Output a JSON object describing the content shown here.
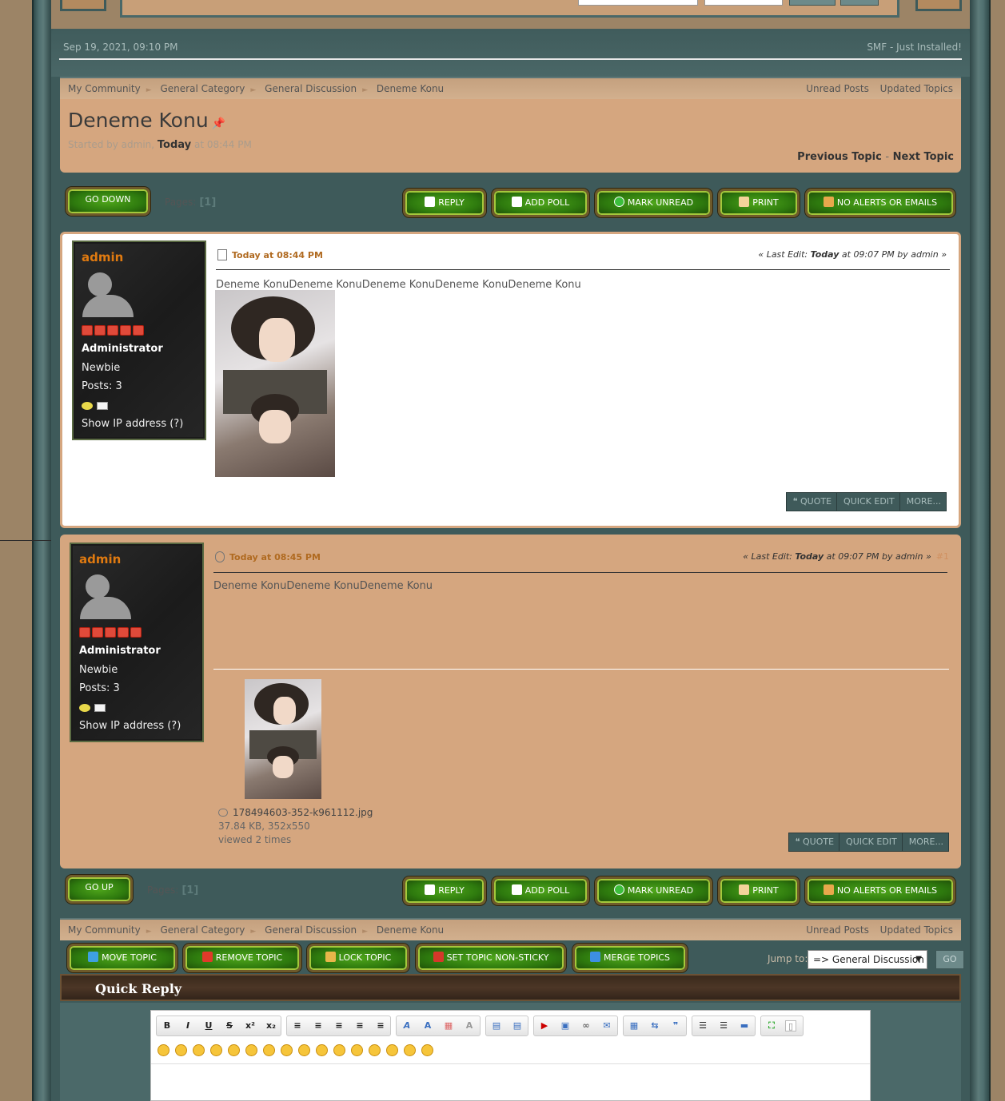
{
  "header": {
    "date": "Sep 19, 2021, 09:10 PM",
    "slogan": "SMF - Just Installed!"
  },
  "nav": {
    "crumbs": [
      "My Community",
      "General Category",
      "General Discussion",
      "Deneme Konu"
    ],
    "links": [
      "Unread Posts",
      "Updated Topics"
    ]
  },
  "topic": {
    "title": "Deneme Konu",
    "started_prefix": "Started by admin,",
    "started_today": "Today",
    "started_time": "at 08:44 PM",
    "prev": "Previous Topic",
    "next": "Next Topic",
    "dash": "-"
  },
  "buttons": {
    "go_down": "GO DOWN",
    "go_up": "GO UP",
    "pages_label": "Pages:",
    "pages_current": "[1]",
    "reply": "REPLY",
    "add_poll": "ADD POLL",
    "mark_unread": "MARK UNREAD",
    "print": "PRINT",
    "no_alerts": "NO ALERTS OR EMAILS"
  },
  "poster": {
    "name": "admin",
    "group": "Administrator",
    "rank": "Newbie",
    "posts": "Posts: 3",
    "show_ip": "Show IP address (?)"
  },
  "posts": [
    {
      "time": "Today at 08:44 PM",
      "edit_prefix": "« Last Edit: ",
      "edit_today": "Today",
      "edit_suffix": " at 09:07 PM by admin »",
      "body": "Deneme KonuDeneme KonuDeneme KonuDeneme KonuDeneme Konu",
      "number": ""
    },
    {
      "time": "Today at 08:45 PM",
      "edit_prefix": "« Last Edit: ",
      "edit_today": "Today",
      "edit_suffix": " at 09:07 PM by admin »",
      "body": "Deneme KonuDeneme KonuDeneme Konu",
      "number": "#1",
      "attachment": {
        "filename": "178494603-352-k961112.jpg",
        "size": "37.84 KB, 352x550",
        "views": "viewed 2 times"
      }
    }
  ],
  "quick_buttons": {
    "quote": "Quote",
    "quick_edit": "Quick Edit",
    "more": "More..."
  },
  "mod": {
    "move": "MOVE TOPIC",
    "remove": "REMOVE TOPIC",
    "lock": "LOCK TOPIC",
    "sticky": "SET TOPIC NON-STICKY",
    "merge": "MERGE TOPICS",
    "jump_label": "Jump to:",
    "jump_value": "=> General Discussion",
    "go": "GO"
  },
  "quick_reply": {
    "title": "Quick Reply",
    "toolbar": [
      "B",
      "I",
      "U",
      "S",
      "x²",
      "x₂"
    ]
  },
  "colors": {
    "accent_orange": "#e07a10",
    "teal": "#3e5a5a",
    "tan": "#d5a67f",
    "button_green": "#2e7a0e"
  }
}
